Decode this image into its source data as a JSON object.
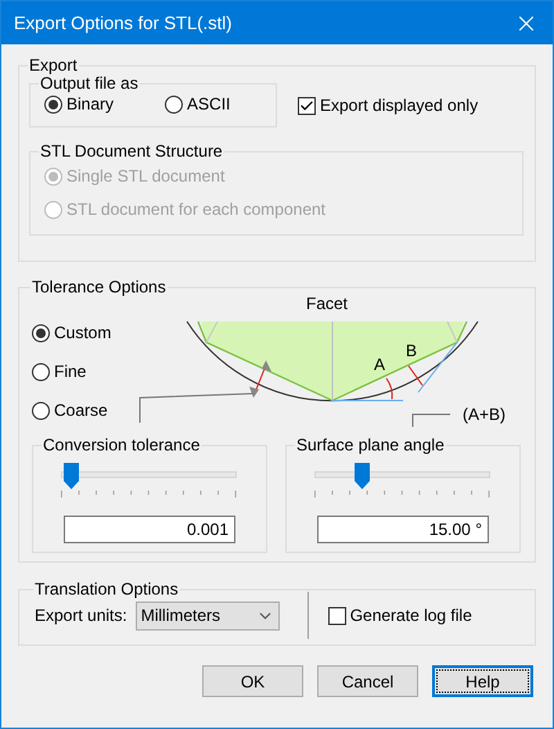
{
  "window": {
    "title": "Export Options for STL(.stl)"
  },
  "export": {
    "legend": "Export",
    "output": {
      "legend": "Output file as",
      "options": [
        {
          "label": "Binary",
          "selected": true
        },
        {
          "label": "ASCII",
          "selected": false
        }
      ]
    },
    "displayed_only": {
      "label": "Export displayed only",
      "checked": true
    },
    "structure": {
      "legend": "STL Document Structure",
      "disabled": true,
      "options": [
        {
          "label": "Single STL document",
          "selected": true
        },
        {
          "label": "STL document for each component",
          "selected": false
        }
      ]
    }
  },
  "tolerance": {
    "legend": "Tolerance Options",
    "presets": [
      {
        "label": "Custom",
        "selected": true
      },
      {
        "label": "Fine",
        "selected": false
      },
      {
        "label": "Coarse",
        "selected": false
      }
    ],
    "diagram": {
      "title": "Facet",
      "label_a": "A",
      "label_b": "B",
      "label_sum": "(A+B)"
    },
    "conversion": {
      "legend": "Conversion tolerance",
      "level": 0.05,
      "value": "0.001"
    },
    "angle": {
      "legend": "Surface plane angle",
      "level": 0.26,
      "value": "15.00 °"
    }
  },
  "translation": {
    "legend": "Translation Options",
    "units_label": "Export units:",
    "units": "Millimeters",
    "log": {
      "label": "Generate log file",
      "checked": false
    }
  },
  "buttons": [
    {
      "label": "OK",
      "focused": false
    },
    {
      "label": "Cancel",
      "focused": false
    },
    {
      "label": "Help",
      "focused": true
    }
  ]
}
